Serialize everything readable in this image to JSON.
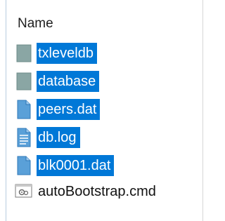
{
  "header": {
    "name_label": "Name"
  },
  "files": [
    {
      "name": "txleveldb",
      "type": "folder",
      "selected": true
    },
    {
      "name": "database",
      "type": "folder",
      "selected": true
    },
    {
      "name": "peers.dat",
      "type": "file",
      "selected": true
    },
    {
      "name": "db.log",
      "type": "text-file",
      "selected": true
    },
    {
      "name": "blk0001.dat",
      "type": "file",
      "selected": true
    },
    {
      "name": "autoBootstrap.cmd",
      "type": "cmd-file",
      "selected": false
    }
  ],
  "colors": {
    "selection": "#0078d7",
    "selection_text": "#ffffff",
    "folder_icon": "#8aa6a4",
    "file_icon": "#5aa0d8"
  }
}
